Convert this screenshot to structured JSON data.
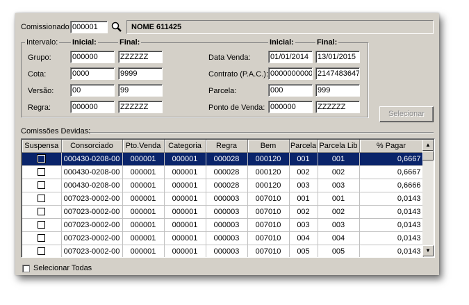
{
  "header": {
    "comissionado_label": "Comissionado:",
    "comissionado_value": "000001",
    "nome": "NOME 611425"
  },
  "intervalo": {
    "title": "Intervalo:",
    "inicial_label": "Inicial:",
    "final_label": "Final:",
    "left_rows": [
      {
        "label": "Grupo:",
        "inicial": "000000",
        "final": "ZZZZZZ"
      },
      {
        "label": "Cota:",
        "inicial": "0000",
        "final": "9999"
      },
      {
        "label": "Versão:",
        "inicial": "00",
        "final": "99"
      },
      {
        "label": "Regra:",
        "inicial": "000000",
        "final": "ZZZZZZ"
      }
    ],
    "right_rows": [
      {
        "label": "Data Venda:",
        "inicial": "01/01/2014",
        "final": "13/01/2015"
      },
      {
        "label": "Contrato (P.A.C.):",
        "inicial": "0000000000",
        "final": "2147483647"
      },
      {
        "label": "Parcela:",
        "inicial": "000",
        "final": "999"
      },
      {
        "label": "Ponto de Venda:",
        "inicial": "000000",
        "final": "ZZZZZZ"
      }
    ]
  },
  "selecionar_button": "Selecionar",
  "comissoes": {
    "title": "Comissões Devidas:",
    "columns": [
      "Suspensa",
      "Consorciado",
      "Pto.Venda",
      "Categoria",
      "Regra",
      "Bem",
      "Parcela",
      "Parcela Lib",
      "% Pagar"
    ],
    "rows": [
      {
        "consorciado": "000430-0208-00",
        "pto_venda": "000001",
        "categoria": "000001",
        "regra": "000028",
        "bem": "000120",
        "parcela": "001",
        "parcela_lib": "001",
        "pagar": "0,6667"
      },
      {
        "consorciado": "000430-0208-00",
        "pto_venda": "000001",
        "categoria": "000001",
        "regra": "000028",
        "bem": "000120",
        "parcela": "002",
        "parcela_lib": "002",
        "pagar": "0,6667"
      },
      {
        "consorciado": "000430-0208-00",
        "pto_venda": "000001",
        "categoria": "000001",
        "regra": "000028",
        "bem": "000120",
        "parcela": "003",
        "parcela_lib": "003",
        "pagar": "0,6666"
      },
      {
        "consorciado": "007023-0002-00",
        "pto_venda": "000001",
        "categoria": "000001",
        "regra": "000003",
        "bem": "007010",
        "parcela": "001",
        "parcela_lib": "001",
        "pagar": "0,0143"
      },
      {
        "consorciado": "007023-0002-00",
        "pto_venda": "000001",
        "categoria": "000001",
        "regra": "000003",
        "bem": "007010",
        "parcela": "002",
        "parcela_lib": "002",
        "pagar": "0,0143"
      },
      {
        "consorciado": "007023-0002-00",
        "pto_venda": "000001",
        "categoria": "000001",
        "regra": "000003",
        "bem": "007010",
        "parcela": "003",
        "parcela_lib": "003",
        "pagar": "0,0143"
      },
      {
        "consorciado": "007023-0002-00",
        "pto_venda": "000001",
        "categoria": "000001",
        "regra": "000003",
        "bem": "007010",
        "parcela": "004",
        "parcela_lib": "004",
        "pagar": "0,0143"
      },
      {
        "consorciado": "007023-0002-00",
        "pto_venda": "000001",
        "categoria": "000001",
        "regra": "000003",
        "bem": "007010",
        "parcela": "005",
        "parcela_lib": "005",
        "pagar": "0,0143"
      }
    ]
  },
  "selecionar_todas_label": "Selecionar Todas",
  "colors": {
    "selection": "#0a246a",
    "window": "#d4d0c8"
  }
}
